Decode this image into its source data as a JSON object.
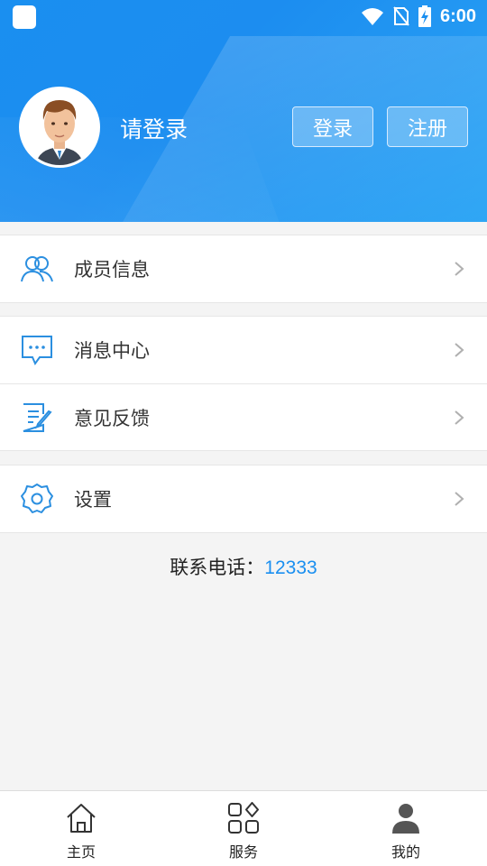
{
  "status_bar": {
    "time": "6:00"
  },
  "header": {
    "login_prompt": "请登录",
    "login_button": "登录",
    "register_button": "注册"
  },
  "menu": {
    "group1": [
      {
        "label": "成员信息",
        "icon": "members-icon"
      }
    ],
    "group2": [
      {
        "label": "消息中心",
        "icon": "message-icon"
      },
      {
        "label": "意见反馈",
        "icon": "feedback-icon"
      }
    ],
    "group3": [
      {
        "label": "设置",
        "icon": "settings-icon"
      }
    ]
  },
  "contact": {
    "label": "联系电话：",
    "phone": "12333"
  },
  "tabbar": {
    "tabs": [
      {
        "label": "主页",
        "icon": "home-icon"
      },
      {
        "label": "服务",
        "icon": "services-icon"
      },
      {
        "label": "我的",
        "icon": "profile-icon",
        "active": true
      }
    ]
  },
  "colors": {
    "accent": "#1a8ff0",
    "icon_blue": "#2b8fe0"
  }
}
